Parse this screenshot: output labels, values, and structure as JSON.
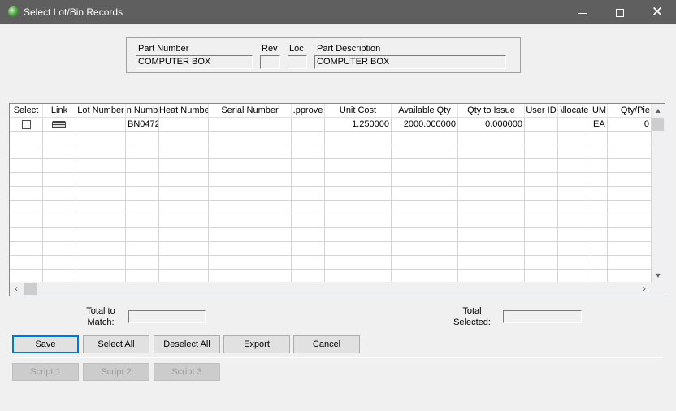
{
  "window": {
    "title": "Select Lot/Bin Records",
    "minimize_icon": "minimize-icon",
    "maximize_icon": "maximize-icon",
    "close_glyph": "✕"
  },
  "header": {
    "part_number_label": "Part Number",
    "part_number_value": "COMPUTER BOX",
    "rev_label": "Rev",
    "rev_value": "",
    "loc_label": "Loc",
    "loc_value": "",
    "part_description_label": "Part Description",
    "part_description_value": "COMPUTER BOX"
  },
  "grid": {
    "columns": [
      "Select",
      "Link",
      "Lot Number",
      "n Numb",
      "Heat Numbe",
      "Serial Number",
      ".pprove",
      "Unit Cost",
      "Available Qty",
      "Qty to Issue",
      "User ID",
      "\\llocate",
      "UM",
      "Qty/Pie"
    ],
    "rows": [
      {
        "checked": false,
        "lot_number": "",
        "bin_number": "BN0472",
        "heat_number": "",
        "serial_number": "",
        "approved": "",
        "unit_cost": "1.250000",
        "available_qty": "2000.000000",
        "qty_to_issue": "0.000000",
        "user_id": "",
        "allocated": "",
        "um": "EA",
        "qty_per_piece": "0"
      }
    ]
  },
  "totals": {
    "total_to_match_line1": "Total to",
    "total_to_match_line2": "Match:",
    "total_selected_line1": "Total",
    "total_selected_line2": "Selected:"
  },
  "buttons": {
    "save_prefix": "",
    "save_mnemonic": "S",
    "save_rest": "ave",
    "select_all": "Select All",
    "deselect_all": "Deselect All",
    "export_prefix": "",
    "export_mnemonic": "E",
    "export_rest": "xport",
    "cancel_prefix": "Ca",
    "cancel_mnemonic": "n",
    "cancel_rest": "cel",
    "script1": "Script 1",
    "script2": "Script 2",
    "script3": "Script 3"
  }
}
